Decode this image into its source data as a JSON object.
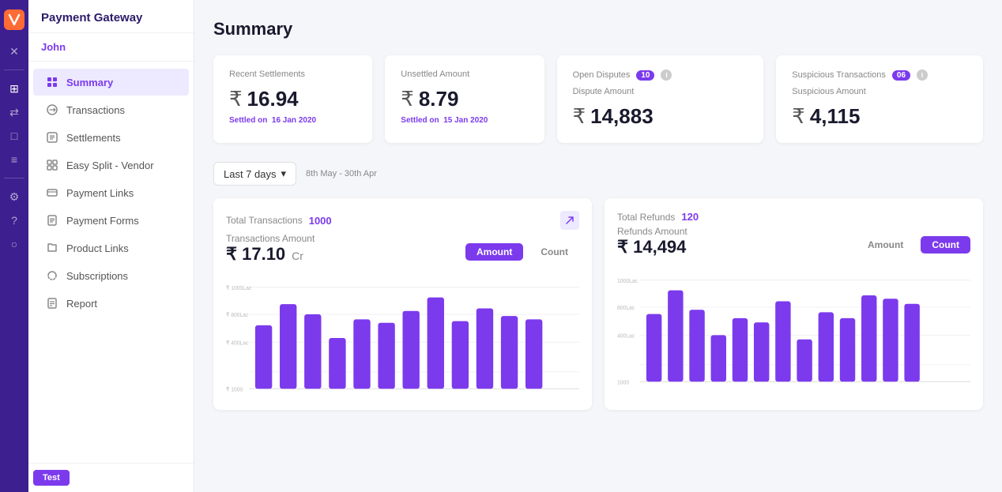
{
  "app": {
    "logo": "F",
    "title": "Payment Gateway"
  },
  "user": {
    "name": "John"
  },
  "nav": {
    "items": [
      {
        "id": "summary",
        "label": "Summary",
        "active": true,
        "icon": "grid"
      },
      {
        "id": "transactions",
        "label": "Transactions",
        "active": false,
        "icon": "repeat"
      },
      {
        "id": "settlements",
        "label": "Settlements",
        "active": false,
        "icon": "box"
      },
      {
        "id": "easy-split",
        "label": "Easy Split - Vendor",
        "active": false,
        "icon": "grid-small"
      },
      {
        "id": "payment-links",
        "label": "Payment Links",
        "active": false,
        "icon": "link"
      },
      {
        "id": "payment-forms",
        "label": "Payment Forms",
        "active": false,
        "icon": "file"
      },
      {
        "id": "product-links",
        "label": "Product Links",
        "active": false,
        "icon": "tag"
      },
      {
        "id": "subscriptions",
        "label": "Subscriptions",
        "active": false,
        "icon": "refresh"
      },
      {
        "id": "report",
        "label": "Report",
        "active": false,
        "icon": "doc"
      }
    ]
  },
  "test_badge": "Test",
  "page_title": "Summary",
  "cards": [
    {
      "id": "recent-settlements",
      "label": "Recent Settlements",
      "amount": "16.94",
      "sub_label": "Settled on",
      "sub_date": "16 Jan 2020"
    },
    {
      "id": "unsettled-amount",
      "label": "Unsettled Amount",
      "amount": "8.79",
      "sub_label": "Settled on",
      "sub_date": "15 Jan 2020"
    },
    {
      "id": "open-disputes",
      "label": "Open Disputes",
      "badge": "10",
      "sub_label": "Dispute Amount",
      "amount": "14,883"
    },
    {
      "id": "suspicious-transactions",
      "label": "Suspicious Transactions",
      "badge": "06",
      "sub_label": "Suspicious Amount",
      "amount": "4,115"
    }
  ],
  "filter": {
    "label": "Last 7 days",
    "date_range": "8th May - 30th Apr"
  },
  "transactions_chart": {
    "title": "Total Transactions",
    "count": "1000",
    "sub_label": "Transactions Amount",
    "amount": "17.10",
    "unit": "Cr",
    "toggle_amount": "Amount",
    "toggle_count": "Count",
    "active_toggle": "amount",
    "y_labels": [
      "₹ 1000Lac",
      "₹ 800Lac",
      "₹ 400Lac",
      "₹ 1000"
    ],
    "bars": [
      40,
      75,
      60,
      35,
      55,
      50,
      65,
      80,
      55,
      70,
      60,
      55
    ]
  },
  "refunds_chart": {
    "title": "Total Refunds",
    "count": "120",
    "sub_label": "Refunds Amount",
    "amount": "14,494",
    "toggle_amount": "Amount",
    "toggle_count": "Count",
    "active_toggle": "count",
    "y_labels": [
      "1000Lac",
      "800Lac",
      "400Lac",
      "1000"
    ],
    "bars": [
      45,
      80,
      55,
      30,
      50,
      45,
      70,
      35,
      60,
      55,
      75,
      70,
      65
    ]
  }
}
